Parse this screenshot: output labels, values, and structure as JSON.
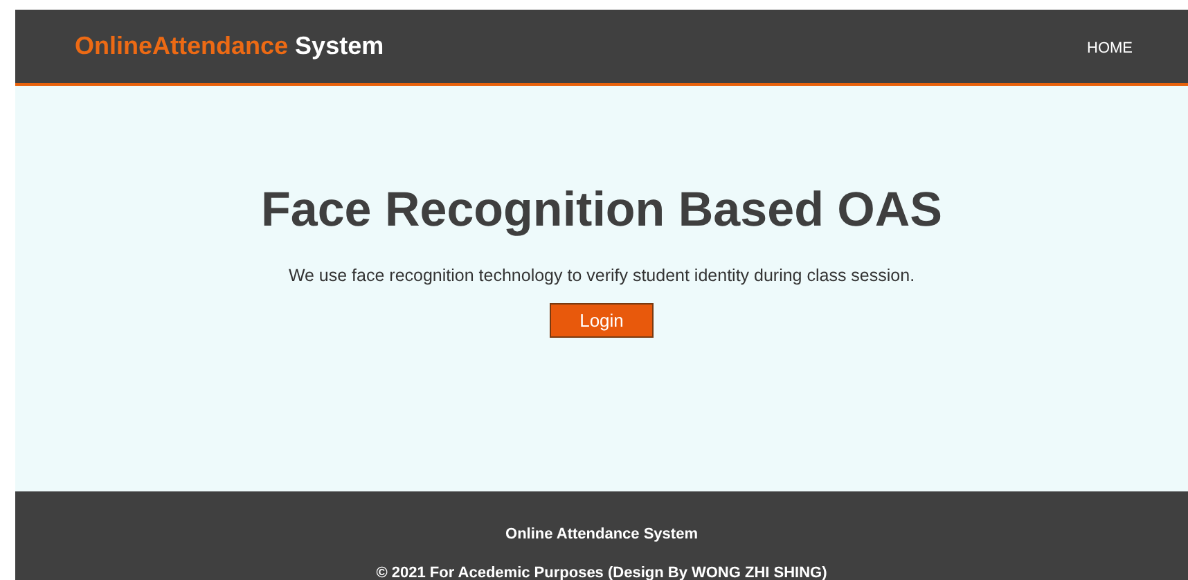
{
  "header": {
    "logo": {
      "highlight": "OnlineAttendance",
      "rest": "System"
    },
    "nav": [
      {
        "label": "HOME"
      }
    ]
  },
  "hero": {
    "title": "Face Recognition Based OAS",
    "text": "We use face recognition technology to verify student identity during class session.",
    "button": "Login"
  },
  "footer": {
    "title": "Online Attendance System",
    "copyright": "© 2021 For Acedemic Purposes (Design By WONG ZHI SHING)"
  }
}
